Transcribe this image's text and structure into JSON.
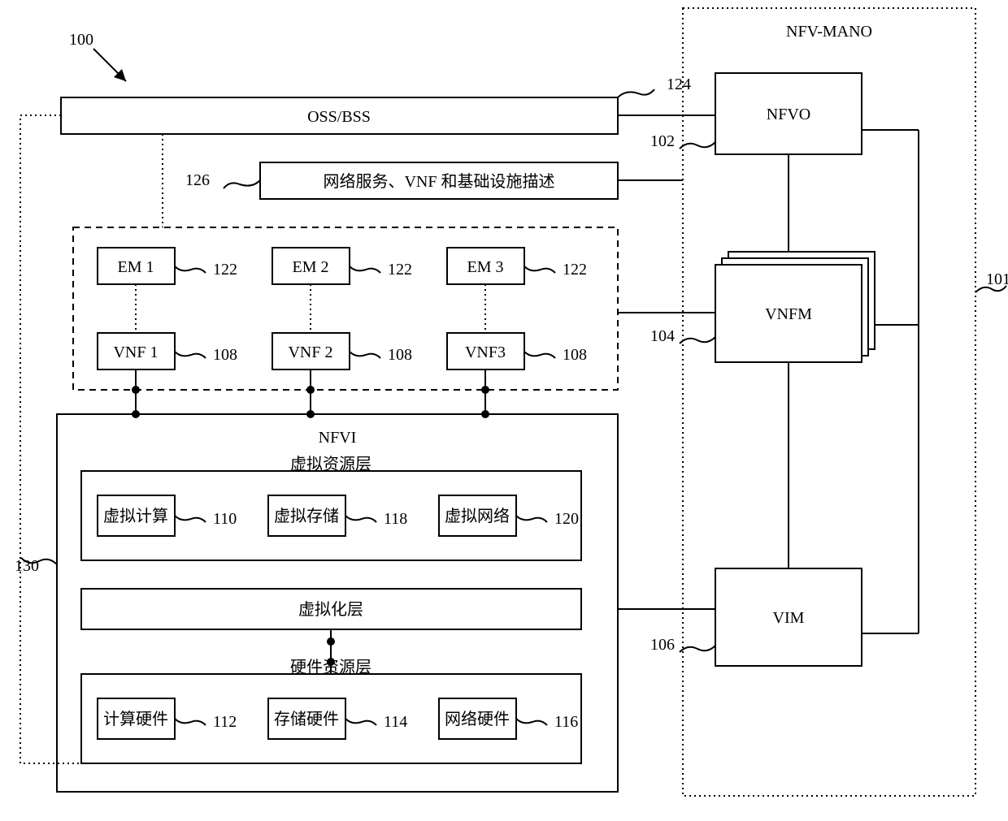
{
  "refs": {
    "main": "100",
    "mano": "101",
    "nfvo": "102",
    "vnfm": "104",
    "vim": "106",
    "vnf": "108",
    "vcompute": "110",
    "chw": "112",
    "shw": "114",
    "nhw": "116",
    "vstorage": "118",
    "vnetwork": "120",
    "em": "122",
    "ossbss": "124",
    "desc": "126",
    "nfvi": "130"
  },
  "labels": {
    "mano_title": "NFV-MANO",
    "ossbss": "OSS/BSS",
    "desc": "网络服务、VNF 和基础设施描述",
    "em1": "EM 1",
    "em2": "EM 2",
    "em3": "EM 3",
    "vnf1": "VNF 1",
    "vnf2": "VNF 2",
    "vnf3": "VNF3",
    "nfvi": "NFVI",
    "vres": "虚拟资源层",
    "vcompute": "虚拟计算",
    "vstorage": "虚拟存储",
    "vnetwork": "虚拟网络",
    "vlayer": "虚拟化层",
    "hwres": "硬件资源层",
    "chw": "计算硬件",
    "shw": "存储硬件",
    "nhw": "网络硬件",
    "nfvo": "NFVO",
    "vnfm": "VNFM",
    "vim": "VIM"
  }
}
